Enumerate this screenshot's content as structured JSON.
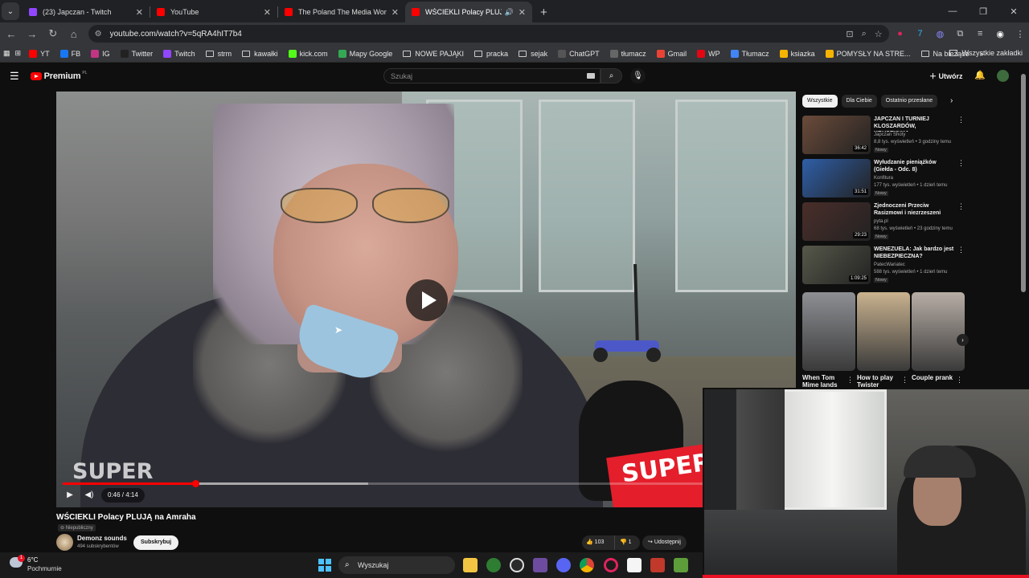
{
  "browser": {
    "tabs": [
      {
        "title": "(23) Japczan - Twitch",
        "fav_color": "#9146ff",
        "active": false
      },
      {
        "title": "YouTube",
        "fav_color": "#ff0000",
        "active": false
      },
      {
        "title": "The Poland The Media Won't Sh",
        "fav_color": "#ff0000",
        "active": false
      },
      {
        "title": "WŚCIEKLI Polacy PLUJĄ na A",
        "fav_color": "#ff0000",
        "active": true
      }
    ],
    "url": "youtube.com/watch?v=5qRA4hIT7b4",
    "bookmarks": [
      {
        "label": "YT",
        "kind": "site",
        "color": "#ff0000"
      },
      {
        "label": "FB",
        "kind": "site",
        "color": "#1877f2"
      },
      {
        "label": "IG",
        "kind": "site",
        "color": "#c13584"
      },
      {
        "label": "Twitter",
        "kind": "site",
        "color": "#222222"
      },
      {
        "label": "Twitch",
        "kind": "site",
        "color": "#9146ff"
      },
      {
        "label": "strm",
        "kind": "folder"
      },
      {
        "label": "kawałki",
        "kind": "folder"
      },
      {
        "label": "kick.com",
        "kind": "site",
        "color": "#53fc18"
      },
      {
        "label": "Mapy Google",
        "kind": "site",
        "color": "#34a853"
      },
      {
        "label": "NOWE PAJĄKI",
        "kind": "folder"
      },
      {
        "label": "pracka",
        "kind": "folder"
      },
      {
        "label": "sejak",
        "kind": "folder"
      },
      {
        "label": "ChatGPT",
        "kind": "site",
        "color": "#555555"
      },
      {
        "label": "tłumacz",
        "kind": "site",
        "color": "#666666"
      },
      {
        "label": "Gmail",
        "kind": "site",
        "color": "#ea4335"
      },
      {
        "label": "WP",
        "kind": "site",
        "color": "#e30613"
      },
      {
        "label": "Tłumacz",
        "kind": "site",
        "color": "#4285f4"
      },
      {
        "label": "ksiazka",
        "kind": "site",
        "color": "#f4b400"
      },
      {
        "label": "POMYSŁY NA STRE...",
        "kind": "site",
        "color": "#f4b400"
      },
      {
        "label": "Na bieżąco",
        "kind": "folder"
      }
    ],
    "all_bookmarks": "Wszystkie zakładki"
  },
  "youtube": {
    "logo": "Premium",
    "logo_country": "PL",
    "search_placeholder": "Szukaj",
    "create_label": "Utwórz",
    "video": {
      "title": "WŚCIEKLI Polacy PLUJĄ na Amraha",
      "badge": "Niepubliczny",
      "time": "0:46 / 4:14",
      "progress": 0.183,
      "buffered": 0.42,
      "watermark": "SUPER",
      "mic_text": "SUPER"
    },
    "channel": {
      "name": "Demonz sounds",
      "subs": "494 subskrybentów"
    },
    "subscribe_label": "Subskrybuj",
    "likes": "103",
    "dislikes": "1",
    "share_label": "Udostępnij",
    "chips": [
      "Wszystkie",
      "Dla Ciebie",
      "Ostatnio przesłane"
    ],
    "recommendations": [
      {
        "title": "JAPCZAN I TURNIEJ KLOSZARDÓW, KRUSZYNKA, ...",
        "channel": "Japczan Shoty",
        "meta": "8,8 tys. wyświetleń • 3 godziny temu",
        "badge": "Nowy",
        "duration": "36:42",
        "thumb": "#6b4b3a"
      },
      {
        "title": "Wyłudzanie pieniążków (Giełda - Odc. 8)",
        "channel": "Konfitura",
        "meta": "177 tys. wyświetleń • 1 dzień temu",
        "badge": "Nowy",
        "duration": "31:51",
        "thumb": "#2f5fa8"
      },
      {
        "title": "Zjednoczeni Przeciw Rasizmowi i niezrzeszeni",
        "channel": "pyta.pl",
        "meta": "68 tys. wyświetleń • 23 godziny temu",
        "badge": "Nowy",
        "duration": "29:23",
        "thumb": "#4a2e2a"
      },
      {
        "title": "WENEZUELA: Jak bardzo jest NIEBEZPIECZNA?",
        "channel": "PatecWariatec",
        "meta": "588 tys. wyświetleń • 1 dzień temu",
        "badge": "Nowy",
        "duration": "1:09:25",
        "thumb": "#57584a"
      }
    ],
    "shorts": [
      {
        "title": "When Tom Mime lands",
        "thumb": "#8d8f93"
      },
      {
        "title": "How to play Twister",
        "thumb": "#c9b28f"
      },
      {
        "title": "Couple prank",
        "thumb": "#b8aea6"
      }
    ]
  },
  "taskbar": {
    "weather_temp": "6°C",
    "weather_desc": "Pochmurnie",
    "weather_alert": "1",
    "search_label": "Wyszukaj"
  }
}
